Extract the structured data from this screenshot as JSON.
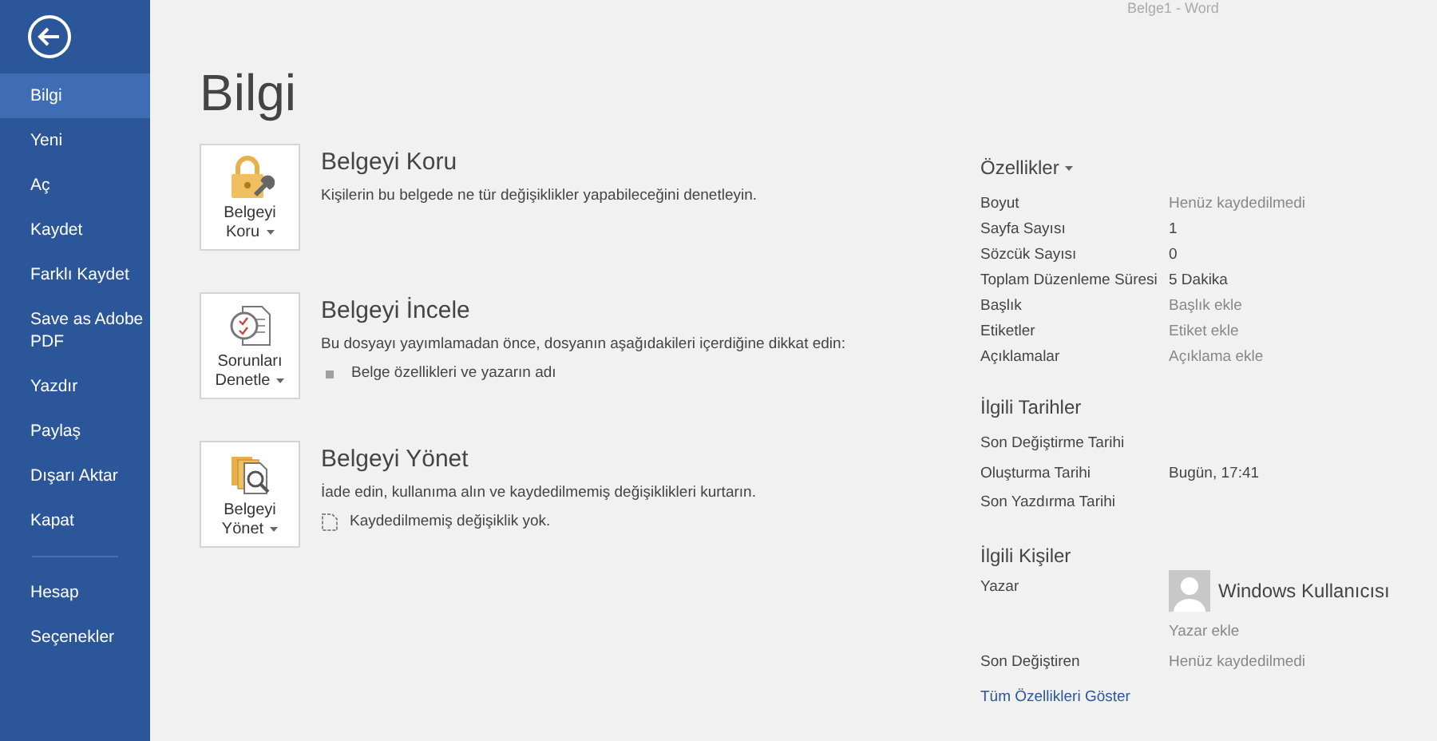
{
  "window": {
    "title": "Belge1 - Word"
  },
  "sidebar": {
    "items": [
      {
        "label": "Bilgi",
        "selected": true
      },
      {
        "label": "Yeni",
        "selected": false
      },
      {
        "label": "Aç",
        "selected": false
      },
      {
        "label": "Kaydet",
        "selected": false
      },
      {
        "label": "Farklı Kaydet",
        "selected": false
      },
      {
        "label": "Save as Adobe PDF",
        "selected": false
      },
      {
        "label": "Yazdır",
        "selected": false
      },
      {
        "label": "Paylaş",
        "selected": false
      },
      {
        "label": "Dışarı Aktar",
        "selected": false
      },
      {
        "label": "Kapat",
        "selected": false
      }
    ],
    "bottom_items": [
      {
        "label": "Hesap",
        "selected": false
      },
      {
        "label": "Seçenekler",
        "selected": false
      }
    ]
  },
  "page_title": "Bilgi",
  "sections": [
    {
      "kind": "protect",
      "button": [
        "Belgeyi",
        "Koru"
      ],
      "title": "Belgeyi Koru",
      "description": "Kişilerin bu belgede ne tür değişiklikler yapabileceğini denetleyin."
    },
    {
      "kind": "inspect",
      "button": [
        "Sorunları",
        "Denetle"
      ],
      "title": "Belgeyi İncele",
      "description": "Bu dosyayı yayımlamadan önce, dosyanın aşağıdakileri içerdiğine dikkat edin:",
      "bullet": "Belge özellikleri ve yazarın adı"
    },
    {
      "kind": "manage",
      "button": [
        "Belgeyi",
        "Yönet"
      ],
      "title": "Belgeyi Yönet",
      "description": "İade edin, kullanıma alın ve kaydedilmemiş değişiklikleri kurtarın.",
      "bullet": "Kaydedilmemiş değişiklik yok."
    }
  ],
  "properties": {
    "title": "Özellikler",
    "rows": [
      {
        "label": "Boyut",
        "value": "Henüz kaydedilmedi",
        "kind": "hint"
      },
      {
        "label": "Sayfa Sayısı",
        "value": "1",
        "kind": "value"
      },
      {
        "label": "Sözcük Sayısı",
        "value": "0",
        "kind": "value"
      },
      {
        "label": "Toplam Düzenleme Süresi",
        "value": "5 Dakika",
        "kind": "value"
      },
      {
        "label": "Başlık",
        "value": "Başlık ekle",
        "kind": "hint"
      },
      {
        "label": "Etiketler",
        "value": "Etiket ekle",
        "kind": "hint"
      },
      {
        "label": "Açıklamalar",
        "value": "Açıklama ekle",
        "kind": "hint"
      }
    ]
  },
  "dates": {
    "title": "İlgili Tarihler",
    "rows": [
      {
        "label": "Son Değiştirme Tarihi"
      },
      {
        "label": "Oluşturma Tarihi",
        "value": "Bugün, 17:41"
      },
      {
        "label": "Son Yazdırma Tarihi"
      }
    ]
  },
  "people": {
    "title": "İlgili Kişiler",
    "author_label": "Yazar",
    "author_name": "Windows Kullanıcısı",
    "add_author": "Yazar ekle",
    "last_modified_label": "Son Değiştiren",
    "last_modified_value": "Henüz kaydedilmedi"
  },
  "show_all_link": "Tüm Özellikleri Göster"
}
